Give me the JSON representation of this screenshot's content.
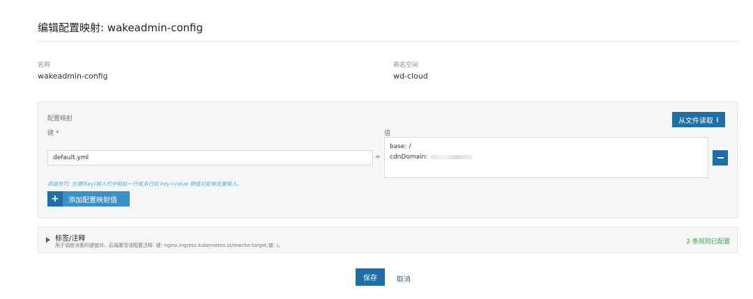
{
  "page": {
    "title": "编辑配置映射: wakeadmin-config"
  },
  "meta": {
    "name_label": "名称",
    "name_value": "wakeadmin-config",
    "namespace_label": "命名空间",
    "namespace_value": "wd-cloud"
  },
  "configmap": {
    "section_title": "配置映射",
    "key_label": "键",
    "required_mark": "*",
    "value_label": "值",
    "read_from_file_label": "从文件读取",
    "key_value": "default.yml",
    "equals": "=",
    "value_lines": [
      "base: /",
      "cdnDomain: "
    ],
    "hint": "高级技巧: 在键(Key)输入栏中粘贴一行或多行的 key=value 键值对能够批量输入。",
    "add_button_label": "添加配置映射值"
  },
  "labels_section": {
    "title": "标签/注释",
    "description": "用于调度决策的键值对。后端重写请配置注释: 键: nginx.ingress.kubernetes.io/rewrite-target,值: /。",
    "rules_count": "2 条规则已配置"
  },
  "actions": {
    "save_label": "保存",
    "cancel_label": "取消"
  },
  "colors": {
    "primary": "#1f6ea6",
    "success": "#3fa543",
    "hint": "#59b4c8",
    "required": "#e53935"
  },
  "icons": [
    "upload-icon",
    "minus-icon",
    "plus-icon",
    "caret-right-icon"
  ]
}
